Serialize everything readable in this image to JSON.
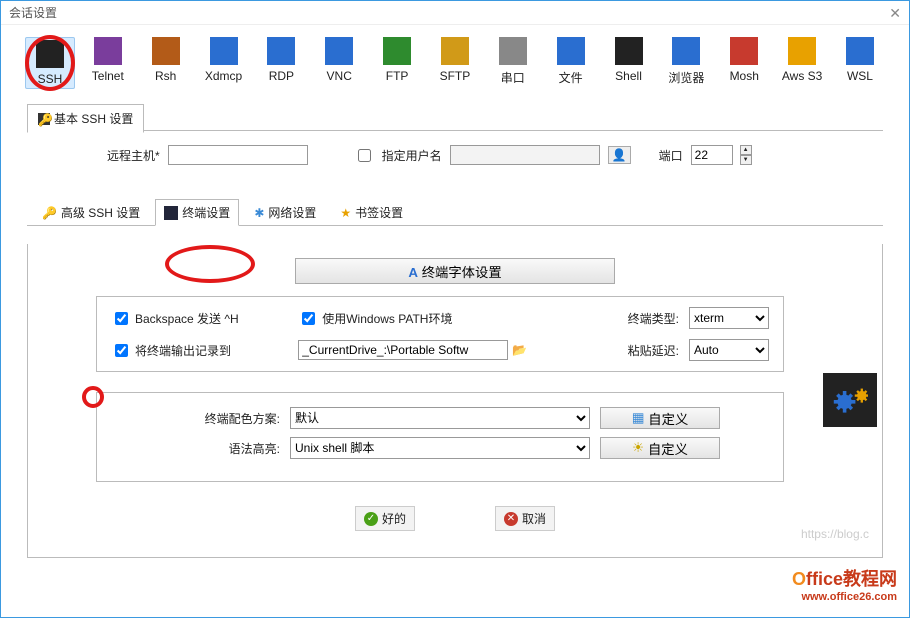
{
  "title": "会话设置",
  "protocols": [
    {
      "label": "SSH"
    },
    {
      "label": "Telnet"
    },
    {
      "label": "Rsh"
    },
    {
      "label": "Xdmcp"
    },
    {
      "label": "RDP"
    },
    {
      "label": "VNC"
    },
    {
      "label": "FTP"
    },
    {
      "label": "SFTP"
    },
    {
      "label": "串口"
    },
    {
      "label": "文件"
    },
    {
      "label": "Shell"
    },
    {
      "label": "浏览器"
    },
    {
      "label": "Mosh"
    },
    {
      "label": "Aws S3"
    },
    {
      "label": "WSL"
    }
  ],
  "proto_colors": [
    "#222",
    "#7a3d9c",
    "#b35b18",
    "#2a6ed0",
    "#2a6ed0",
    "#2a6ed0",
    "#2e8b2e",
    "#d19a18",
    "#888",
    "#2a6ed0",
    "#222",
    "#2a6ed0",
    "#c73a2e",
    "#e8a100",
    "#2a6ed0"
  ],
  "basic_tab": "基本 SSH 设置",
  "remote_host_label": "远程主机*",
  "remote_host_value": "",
  "specify_user_label": "指定用户名",
  "specify_user_checked": false,
  "user_value": "",
  "port_label": "端口",
  "port_value": "22",
  "subtabs": [
    {
      "label": "高级 SSH 设置"
    },
    {
      "label": "终端设置"
    },
    {
      "label": "网络设置"
    },
    {
      "label": "书签设置"
    }
  ],
  "font_button": "终端字体设置",
  "opt_backspace": {
    "label": "Backspace 发送 ^H",
    "checked": true
  },
  "opt_winpath": {
    "label": "使用Windows PATH环境",
    "checked": true
  },
  "term_type_label": "终端类型:",
  "term_type_value": "xterm",
  "opt_logoutput": {
    "label": "将终端输出记录到",
    "checked": true
  },
  "log_path_value": "_CurrentDrive_:\\Portable Softw",
  "paste_delay_label": "粘贴延迟:",
  "paste_delay_value": "Auto",
  "scheme_label": "终端配色方案:",
  "scheme_value": "默认",
  "syntax_label": "语法高亮:",
  "syntax_value": "Unix shell 脚本",
  "custom_label": "自定义",
  "ok_label": "好的",
  "cancel_label": "取消",
  "watermark": "https://blog.c",
  "brand_top": "Office教程网",
  "brand_bot": "www.office26.com"
}
